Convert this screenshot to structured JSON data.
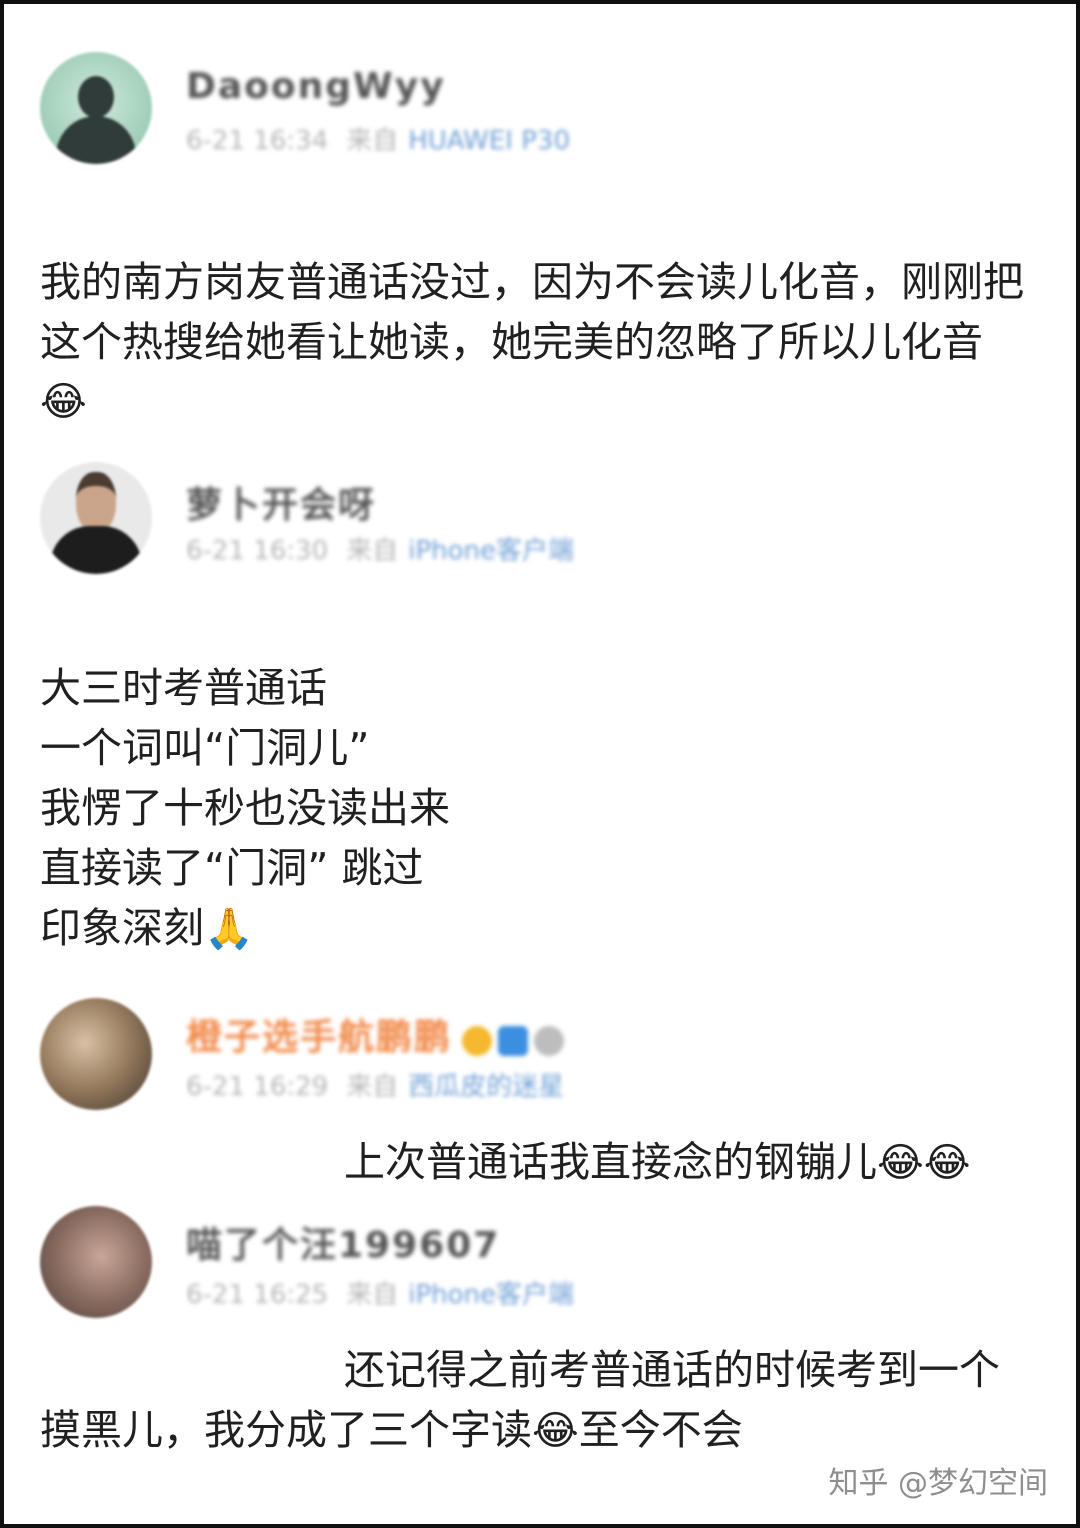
{
  "comments": [
    {
      "username": "DaoongWyy",
      "timestamp": "6-21 16:34",
      "source_prefix": "来自",
      "device": "HUAWEI P30",
      "lines": [
        "我的南方岗友普通话没过，因为不会读儿化音，刚刚把",
        "这个热搜给她看让她读，她完美的忽略了所以儿化音"
      ],
      "emoji": "😂"
    },
    {
      "username": "萝卜开会呀",
      "timestamp": "6-21 16:30",
      "source_prefix": "来自",
      "device": "iPhone客户端",
      "lines": [
        "大三时考普通话",
        "一个词叫“门洞儿”",
        "我愣了十秒也没读出来",
        "直接读了“门洞” 跳过",
        "印象深刻"
      ],
      "emoji": "🙏"
    },
    {
      "username": "橙子选手航鹏鹏",
      "timestamp": "6-21 16:29",
      "source_prefix": "来自",
      "device": "西瓜皮的迷星",
      "lines": [
        "上次普通话我直接念的钢镚儿"
      ],
      "emoji": "😂😂"
    },
    {
      "username": "喵了个汪199607",
      "timestamp": "6-21 16:25",
      "source_prefix": "来自",
      "device": "iPhone客户端",
      "lines": [
        "还记得之前考普通话的时候考到一个",
        "摸黑儿，我分成了三个字读",
        "至今不会"
      ],
      "emoji": "😂"
    }
  ],
  "watermark": "知乎 @梦幻空间",
  "colors": {
    "username_orange": "#f28a4a",
    "device_link": "#6f9fd6",
    "meta_gray": "#b5b5b5"
  }
}
